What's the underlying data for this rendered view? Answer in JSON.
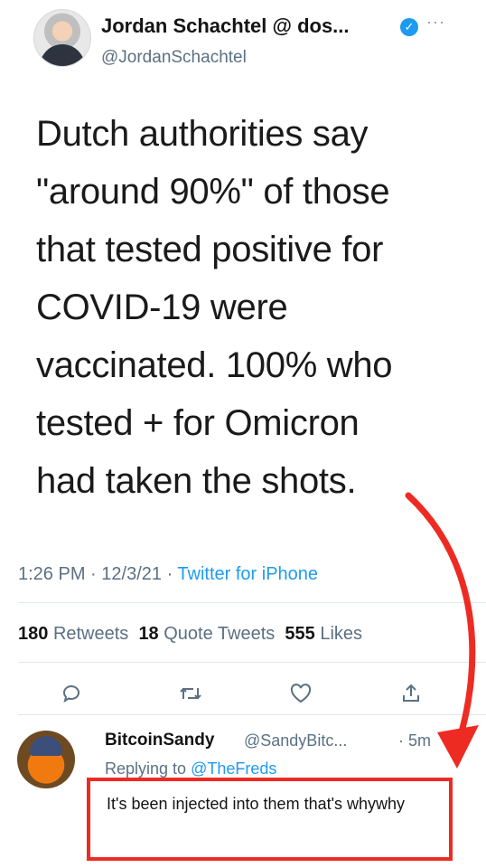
{
  "tweet": {
    "author_name": "Jordan Schachtel @ dos...",
    "author_handle": "@JordanSchachtel",
    "verified_icon": "check-icon",
    "body_lines": [
      "Dutch authorities say",
      "\"around 90%\" of those",
      "that tested positive for",
      "COVID-19 were",
      "vaccinated. 100% who",
      "tested + for Omicron",
      "had taken the shots."
    ],
    "time": "1:26 PM",
    "date": "12/3/21",
    "source": "Twitter for iPhone",
    "stats": {
      "retweets_count": "180",
      "retweets_label": "Retweets",
      "quotes_count": "18",
      "quotes_label": "Quote Tweets",
      "likes_count": "555",
      "likes_label": "Likes"
    }
  },
  "actions": [
    "reply-icon",
    "retweet-icon",
    "like-icon",
    "share-icon"
  ],
  "reply": {
    "author_name": "BitcoinSandy",
    "author_handle": "@SandyBitc...",
    "time": "5m",
    "replying_prefix": "Replying to",
    "replying_to": "@TheFreds",
    "text": "It's been injected into them that's whywhy"
  },
  "annotation": {
    "color": "#ee2b22"
  }
}
